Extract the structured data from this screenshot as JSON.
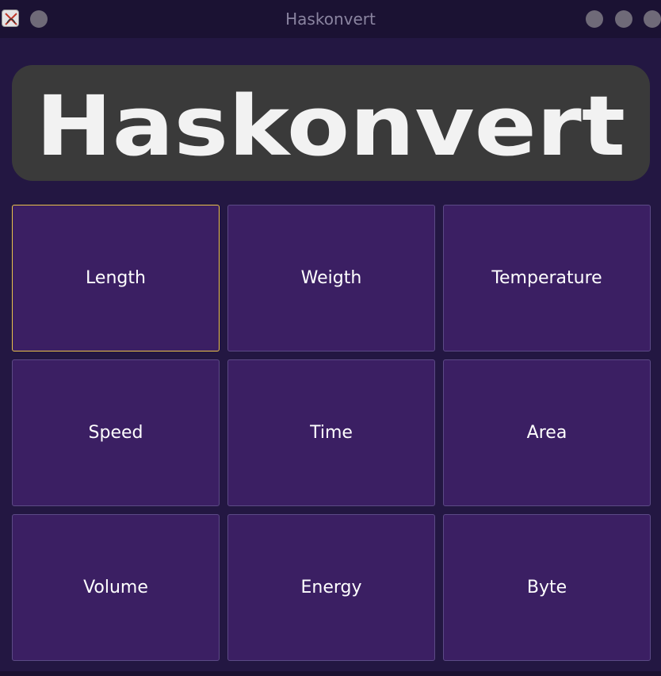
{
  "window": {
    "title": "Haskonvert",
    "logo_text": "Haskonvert"
  },
  "colors": {
    "background": "#231742",
    "titlebar": "#1b1233",
    "card": "#3b1f63",
    "card_border": "#5c4a86",
    "selected_border": "#e9c14a",
    "logo_panel": "#3a3a3a",
    "logo_text": "#f2f2f2"
  },
  "categories": [
    {
      "label": "Length",
      "selected": true
    },
    {
      "label": "Weigth",
      "selected": false
    },
    {
      "label": "Temperature",
      "selected": false
    },
    {
      "label": "Speed",
      "selected": false
    },
    {
      "label": "Time",
      "selected": false
    },
    {
      "label": "Area",
      "selected": false
    },
    {
      "label": "Volume",
      "selected": false
    },
    {
      "label": "Energy",
      "selected": false
    },
    {
      "label": "Byte",
      "selected": false
    }
  ]
}
